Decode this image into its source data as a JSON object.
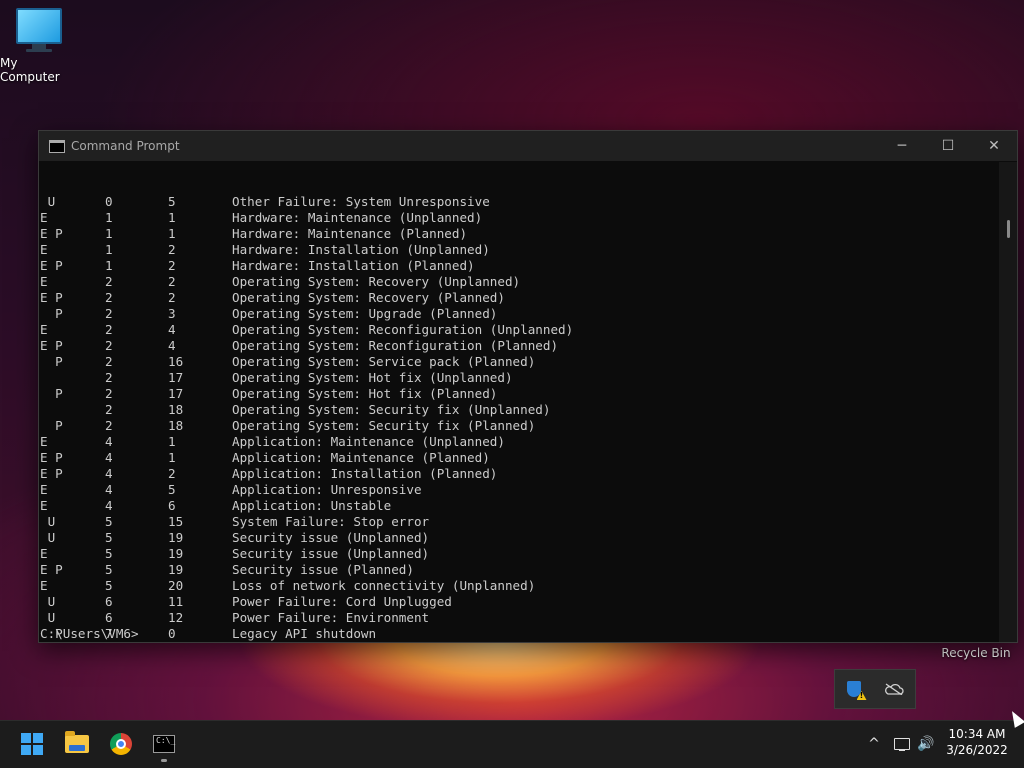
{
  "desktop": {
    "icons": [
      {
        "label": "My Computer"
      },
      {
        "label": "Recycle Bin"
      }
    ]
  },
  "window": {
    "title": "Command Prompt",
    "controls": {
      "minimize": "─",
      "maximize": "☐",
      "close": "✕"
    }
  },
  "console": {
    "rows": [
      {
        "flags": " U",
        "major": "0",
        "minor": "5",
        "description": "Other Failure: System Unresponsive"
      },
      {
        "flags": "E",
        "major": "1",
        "minor": "1",
        "description": "Hardware: Maintenance (Unplanned)"
      },
      {
        "flags": "E P",
        "major": "1",
        "minor": "1",
        "description": "Hardware: Maintenance (Planned)"
      },
      {
        "flags": "E",
        "major": "1",
        "minor": "2",
        "description": "Hardware: Installation (Unplanned)"
      },
      {
        "flags": "E P",
        "major": "1",
        "minor": "2",
        "description": "Hardware: Installation (Planned)"
      },
      {
        "flags": "E",
        "major": "2",
        "minor": "2",
        "description": "Operating System: Recovery (Unplanned)"
      },
      {
        "flags": "E P",
        "major": "2",
        "minor": "2",
        "description": "Operating System: Recovery (Planned)"
      },
      {
        "flags": "  P",
        "major": "2",
        "minor": "3",
        "description": "Operating System: Upgrade (Planned)"
      },
      {
        "flags": "E",
        "major": "2",
        "minor": "4",
        "description": "Operating System: Reconfiguration (Unplanned)"
      },
      {
        "flags": "E P",
        "major": "2",
        "minor": "4",
        "description": "Operating System: Reconfiguration (Planned)"
      },
      {
        "flags": "  P",
        "major": "2",
        "minor": "16",
        "description": "Operating System: Service pack (Planned)"
      },
      {
        "flags": "",
        "major": "2",
        "minor": "17",
        "description": "Operating System: Hot fix (Unplanned)"
      },
      {
        "flags": "  P",
        "major": "2",
        "minor": "17",
        "description": "Operating System: Hot fix (Planned)"
      },
      {
        "flags": "",
        "major": "2",
        "minor": "18",
        "description": "Operating System: Security fix (Unplanned)"
      },
      {
        "flags": "  P",
        "major": "2",
        "minor": "18",
        "description": "Operating System: Security fix (Planned)"
      },
      {
        "flags": "E",
        "major": "4",
        "minor": "1",
        "description": "Application: Maintenance (Unplanned)"
      },
      {
        "flags": "E P",
        "major": "4",
        "minor": "1",
        "description": "Application: Maintenance (Planned)"
      },
      {
        "flags": "E P",
        "major": "4",
        "minor": "2",
        "description": "Application: Installation (Planned)"
      },
      {
        "flags": "E",
        "major": "4",
        "minor": "5",
        "description": "Application: Unresponsive"
      },
      {
        "flags": "E",
        "major": "4",
        "minor": "6",
        "description": "Application: Unstable"
      },
      {
        "flags": " U",
        "major": "5",
        "minor": "15",
        "description": "System Failure: Stop error"
      },
      {
        "flags": " U",
        "major": "5",
        "minor": "19",
        "description": "Security issue (Unplanned)"
      },
      {
        "flags": "E",
        "major": "5",
        "minor": "19",
        "description": "Security issue (Unplanned)"
      },
      {
        "flags": "E P",
        "major": "5",
        "minor": "19",
        "description": "Security issue (Planned)"
      },
      {
        "flags": "E",
        "major": "5",
        "minor": "20",
        "description": "Loss of network connectivity (Unplanned)"
      },
      {
        "flags": " U",
        "major": "6",
        "minor": "11",
        "description": "Power Failure: Cord Unplugged"
      },
      {
        "flags": " U",
        "major": "6",
        "minor": "12",
        "description": "Power Failure: Environment"
      },
      {
        "flags": "  P",
        "major": "7",
        "minor": "0",
        "description": "Legacy API shutdown"
      }
    ],
    "prompt": "C:\\Users\\VM6>"
  },
  "taskbar": {
    "apps": [
      "start-icon",
      "file-explorer-icon",
      "chrome-icon",
      "command-prompt-icon"
    ],
    "tray": {
      "chevron": "^",
      "volume": "🔊"
    },
    "clock": {
      "time": "10:34 AM",
      "date": "3/26/2022"
    }
  }
}
